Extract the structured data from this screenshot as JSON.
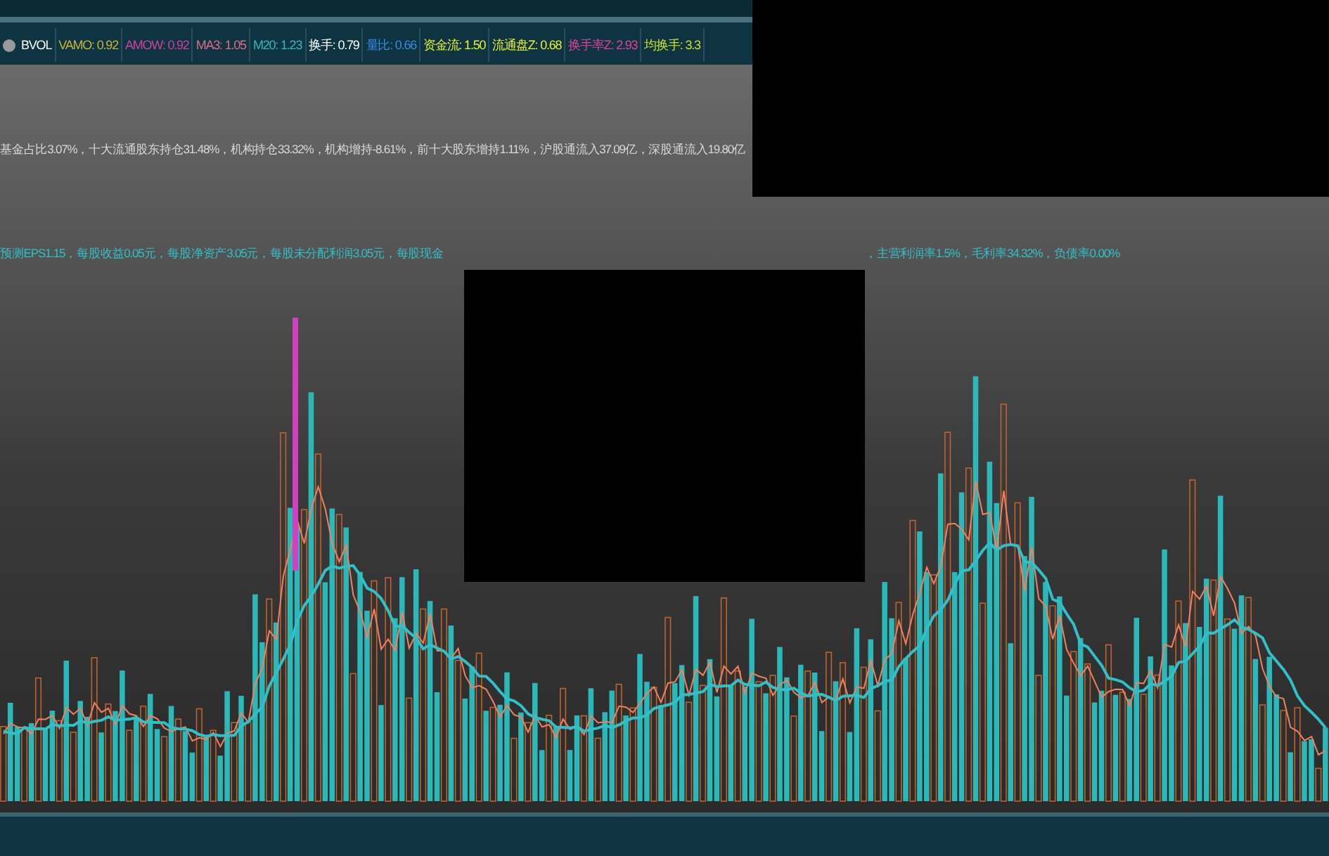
{
  "legend": [
    {
      "text": "BVOL",
      "color": "#ffffff"
    },
    {
      "text": "VAMO: 0.92",
      "color": "#c9b43a"
    },
    {
      "text": "AMOW: 0.92",
      "color": "#d040a0"
    },
    {
      "text": "MA3: 1.05",
      "color": "#e06a8a"
    },
    {
      "text": "M20: 1.23",
      "color": "#2fb8c0"
    },
    {
      "text": "换手: 0.79",
      "color": "#ffffff"
    },
    {
      "text": "量比: 0.66",
      "color": "#3a8ae0"
    },
    {
      "text": "资金流: 1.50",
      "color": "#e8f030"
    },
    {
      "text": "流通盘Z: 0.68",
      "color": "#e8f030"
    },
    {
      "text": "换手率Z: 2.93",
      "color": "#e040a0"
    },
    {
      "text": "均换手: 3.3",
      "color": "#c8e030"
    }
  ],
  "info_lines": [
    {
      "text": "基金占比3.07%，十大流通股东持仓31.48%，机构持仓33.32%，机构增持-8.61%，前十大股东增持1.11%，沪股通流入37.09亿，深股通流入19.80亿",
      "color": "#d8d8d8"
    },
    {
      "text": "预测EPS1.15，每股收益0.05元，每股净资产3.05元，每股未分配利润3.05元，每股现金",
      "color": "#2fc0c8"
    },
    {
      "text": "，主营利润率1.5%，毛利率34.32%，负债率0.00%",
      "color": "#2fc0c8"
    }
  ]
}
